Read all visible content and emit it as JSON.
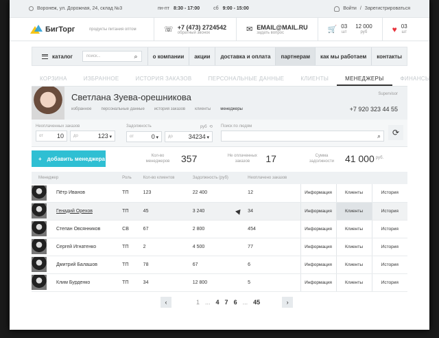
{
  "topbar": {
    "address": "Воронеж, ул. Дорожная, 24, склад №3",
    "weekday_label": "пн-пт",
    "weekday_hours": "8:30 - 17:00",
    "weekend_label": "сб",
    "weekend_hours": "9:00 - 15:00",
    "login": "Войти",
    "register": "Зарегистрироваться"
  },
  "header": {
    "logo": "БигТорг",
    "tagline": "продукты питания оптом",
    "phone": "+7 (473) 2724542",
    "phone_sub": "обратный звонок",
    "email": "EMAIL@MAIL.RU",
    "email_sub": "задать вопрос",
    "cart_count": "03",
    "cart_unit": "шт",
    "cart_total": "12 000",
    "cart_currency": "руб",
    "fav_count": "03",
    "fav_unit": "шт"
  },
  "nav": {
    "catalog": "каталог",
    "search_placeholder": "поиск...",
    "items": [
      "о компании",
      "акции",
      "доставка и оплата",
      "партнерам",
      "как мы работаем",
      "контакты"
    ]
  },
  "tabs": [
    "КОРЗИНА",
    "ИЗБРАННОЕ",
    "ИСТОРИЯ ЗАКАЗОВ",
    "ПЕРСОНАЛЬНЫЕ ДАННЫЕ",
    "КЛИЕНТЫ",
    "МЕНЕДЖЕРЫ",
    "ФИНАНСЫ"
  ],
  "profile": {
    "name": "Светлана Зуева-орешникова",
    "role": "Supervisor",
    "phone": "+7 920 323 44 55",
    "links": [
      "избранное",
      "персональные данные",
      "история заказов",
      "клиенты",
      "менеджеры"
    ]
  },
  "filters": {
    "orders_label": "Неоплаченных заказов",
    "debt_label": "Задолжность",
    "debt_unit": "руб",
    "search_label": "Поиск по людям",
    "from": "от",
    "to": "до",
    "orders_from": "10",
    "orders_to": "123",
    "debt_from": "0",
    "debt_to": "34234"
  },
  "stats": {
    "add_button": "добавить менеджера",
    "managers_label": "Кол-во менеджеров",
    "managers_value": "357",
    "unpaid_label": "Не оплаченных заказов",
    "unpaid_value": "17",
    "debt_label": "Сумма задолжности",
    "debt_value": "41 000",
    "debt_unit": "руб."
  },
  "table": {
    "headers": [
      "Менеджер",
      "Роль",
      "Кол-во клиентов",
      "Задолжность (руб)",
      "Неоплачено заказов"
    ],
    "action_info": "Информация",
    "action_clients": "Клиенты",
    "action_history": "История",
    "rows": [
      {
        "name": "Пётр Иванов",
        "role": "ТП",
        "clients": "123",
        "debt": "22 400",
        "unpaid": "12"
      },
      {
        "name": "Генадий Орехов",
        "role": "ТП",
        "clients": "45",
        "debt": "3 240",
        "unpaid": "34"
      },
      {
        "name": "Степан Овсянников",
        "role": "СВ",
        "clients": "67",
        "debt": "2 800",
        "unpaid": "454"
      },
      {
        "name": "Сергей Игнатенко",
        "role": "ТП",
        "clients": "2",
        "debt": "4 500",
        "unpaid": "77"
      },
      {
        "name": "Дмитрий Балашов",
        "role": "ТП",
        "clients": "78",
        "debt": "67",
        "unpaid": "6"
      },
      {
        "name": "Клим Бурденко",
        "role": "ТП",
        "clients": "34",
        "debt": "12 800",
        "unpaid": "5"
      }
    ]
  },
  "pager": {
    "pages": [
      "1",
      "...",
      "4",
      "7",
      "6",
      "...",
      "45"
    ]
  }
}
